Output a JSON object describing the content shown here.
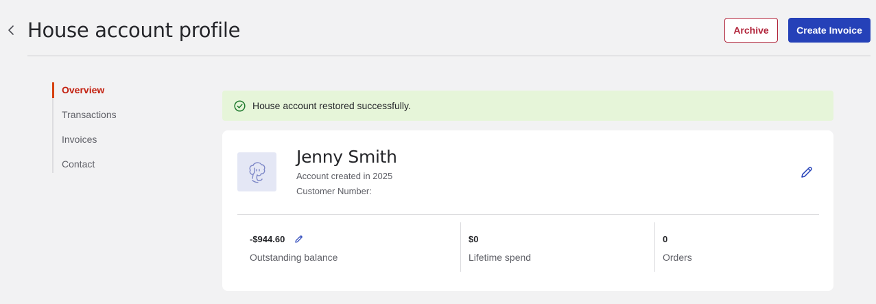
{
  "header": {
    "title": "House account profile",
    "archive_label": "Archive",
    "create_invoice_label": "Create Invoice"
  },
  "sidebar": {
    "items": [
      {
        "label": "Overview",
        "active": true
      },
      {
        "label": "Transactions",
        "active": false
      },
      {
        "label": "Invoices",
        "active": false
      },
      {
        "label": "Contact",
        "active": false
      }
    ]
  },
  "alert": {
    "message": "House account restored successfully."
  },
  "profile": {
    "name": "Jenny Smith",
    "created": "Account created in 2025",
    "customer_number": "Customer Number:"
  },
  "stats": [
    {
      "value": "-$944.60",
      "label": "Outstanding balance"
    },
    {
      "value": "$0",
      "label": "Lifetime spend"
    },
    {
      "value": "0",
      "label": "Orders"
    }
  ],
  "colors": {
    "primary": "#2541b8",
    "danger": "#b1243a",
    "active_nav": "#c3200f",
    "success_bg": "#e6f5d9",
    "success_icon": "#1f7a2e"
  },
  "icons": {
    "back": "chevron-left-icon",
    "success": "check-circle-icon",
    "avatar": "person-placeholder-icon",
    "edit": "pencil-icon"
  }
}
